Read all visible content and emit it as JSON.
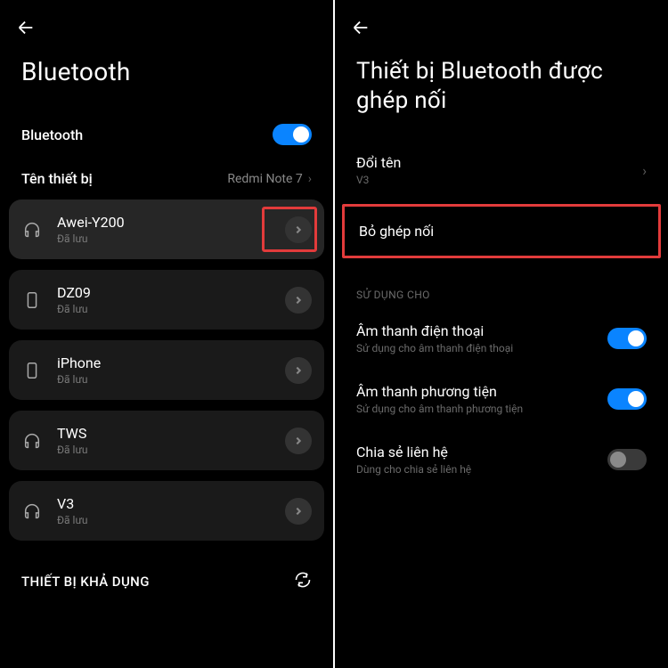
{
  "left": {
    "title": "Bluetooth",
    "bluetooth_row": {
      "label": "Bluetooth",
      "on": true
    },
    "device_name_row": {
      "label": "Tên thiết bị",
      "value": "Redmi Note 7"
    },
    "devices": [
      {
        "name": "Awei-Y200",
        "status": "Đã lưu",
        "icon": "headphones",
        "highlighted": true
      },
      {
        "name": "DZ09",
        "status": "Đã lưu",
        "icon": "phone"
      },
      {
        "name": "iPhone",
        "status": "Đã lưu",
        "icon": "phone"
      },
      {
        "name": "TWS",
        "status": "Đã lưu",
        "icon": "headphones"
      },
      {
        "name": "V3",
        "status": "Đã lưu",
        "icon": "headphones"
      }
    ],
    "available_header": "THIẾT BỊ KHẢ DỤNG"
  },
  "right": {
    "title": "Thiết bị Bluetooth được ghép nối",
    "rename": {
      "label": "Đổi tên",
      "value": "V3"
    },
    "unpair_label": "Bỏ ghép nối",
    "use_for_header": "SỬ DỤNG CHO",
    "uses": [
      {
        "title": "Âm thanh điện thoại",
        "sub": "Sử dụng cho âm thanh điện thoại",
        "on": true
      },
      {
        "title": "Âm thanh phương tiện",
        "sub": "Sử dụng cho âm thanh phương tiện",
        "on": true
      },
      {
        "title": "Chia sẻ liên hệ",
        "sub": "Dùng cho chia sẻ liên hệ",
        "on": false
      }
    ]
  }
}
